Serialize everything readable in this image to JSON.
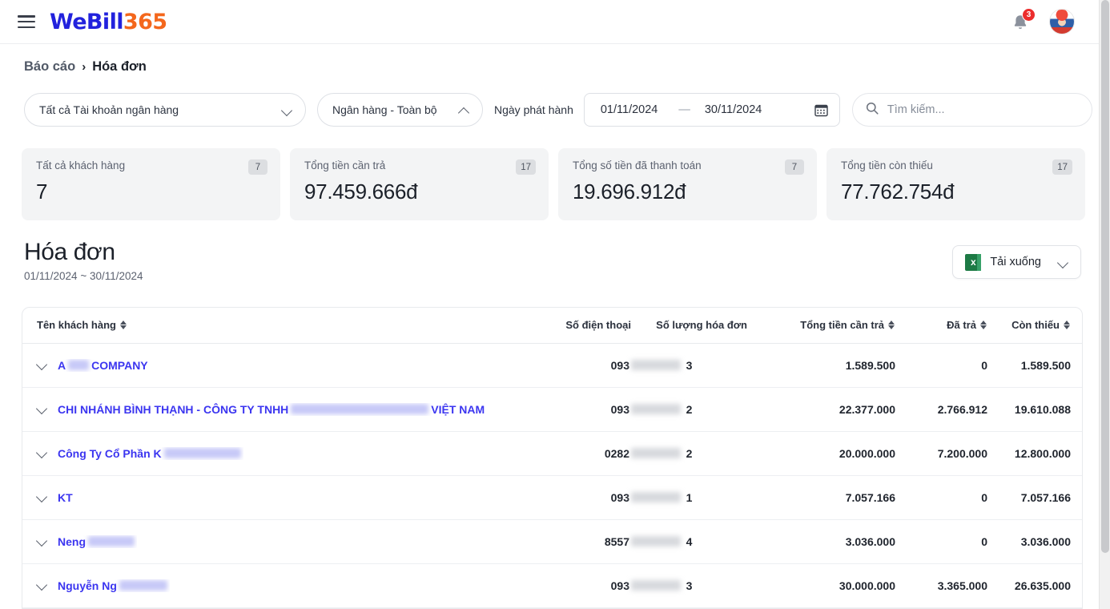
{
  "app": {
    "logo_we": "WeBill",
    "logo_365": "365",
    "menu_icon": "hamburger-icon",
    "notification_count": "3"
  },
  "breadcrumb": {
    "root": "Báo cáo",
    "separator": "›",
    "current": "Hóa đơn"
  },
  "filters": {
    "account_select": "Tất cả Tài khoản ngân hàng",
    "bank_select": "Ngân hàng - Toàn bộ",
    "date_label": "Ngày phát hành",
    "date_from": "01/11/2024",
    "date_dash": "—",
    "date_to": "30/11/2024",
    "search_placeholder": "Tìm kiếm...",
    "search_value": ""
  },
  "stats": [
    {
      "title": "Tất cả khách hàng",
      "badge": "7",
      "value": "7"
    },
    {
      "title": "Tổng tiền cần trả",
      "badge": "17",
      "value": "97.459.666đ"
    },
    {
      "title": "Tổng số tiền đã thanh toán",
      "badge": "7",
      "value": "19.696.912đ"
    },
    {
      "title": "Tổng tiền còn thiếu",
      "badge": "17",
      "value": "77.762.754đ"
    }
  ],
  "page": {
    "title": "Hóa đơn",
    "subtitle": "01/11/2024 ~ 30/11/2024",
    "download_label": "Tải xuống",
    "download_icon": "excel-icon"
  },
  "table": {
    "columns": [
      {
        "label": "Tên khách hàng",
        "sortable": true,
        "align": "left"
      },
      {
        "label": "Số điện thoại",
        "sortable": false,
        "align": "right"
      },
      {
        "label": "Số lượng hóa đơn",
        "sortable": false,
        "align": "center"
      },
      {
        "label": "Tổng tiền cần trả",
        "sortable": true,
        "align": "right"
      },
      {
        "label": "Đã trả",
        "sortable": true,
        "align": "right"
      },
      {
        "label": "Còn thiếu",
        "sortable": true,
        "align": "right"
      }
    ],
    "rows": [
      {
        "name_prefix": "A",
        "name_redacted_width": 26,
        "name_suffix": "COMPANY",
        "phone": "093",
        "invoice_count": "3",
        "total_due": "1.589.500",
        "paid": "0",
        "remaining": "1.589.500"
      },
      {
        "name_prefix": "CHI NHÁNH BÌNH THẠNH - CÔNG TY TNHH",
        "name_redacted_width": 172,
        "name_suffix": "VIỆT NAM",
        "phone": "093",
        "invoice_count": "2",
        "total_due": "22.377.000",
        "paid": "2.766.912",
        "remaining": "19.610.088"
      },
      {
        "name_prefix": "Công Ty Cổ Phần K",
        "name_redacted_width": 96,
        "name_suffix": "",
        "phone": "0282",
        "invoice_count": "2",
        "total_due": "20.000.000",
        "paid": "7.200.000",
        "remaining": "12.800.000"
      },
      {
        "name_prefix": "KT",
        "name_redacted_width": 0,
        "name_suffix": "",
        "phone": "093",
        "invoice_count": "1",
        "total_due": "7.057.166",
        "paid": "0",
        "remaining": "7.057.166"
      },
      {
        "name_prefix": "Neng",
        "name_redacted_width": 58,
        "name_suffix": "",
        "phone": "8557",
        "invoice_count": "4",
        "total_due": "3.036.000",
        "paid": "0",
        "remaining": "3.036.000"
      },
      {
        "name_prefix": "Nguyễn Ng",
        "name_redacted_width": 60,
        "name_suffix": "",
        "phone": "093",
        "invoice_count": "3",
        "total_due": "30.000.000",
        "paid": "3.365.000",
        "remaining": "26.635.000"
      }
    ]
  },
  "colors": {
    "brand_blue": "#2222dd",
    "brand_orange": "#f4671c",
    "link_blue": "#3b35f0",
    "badge_red": "#ec2d2d",
    "card_bg": "#f3f4f5"
  }
}
